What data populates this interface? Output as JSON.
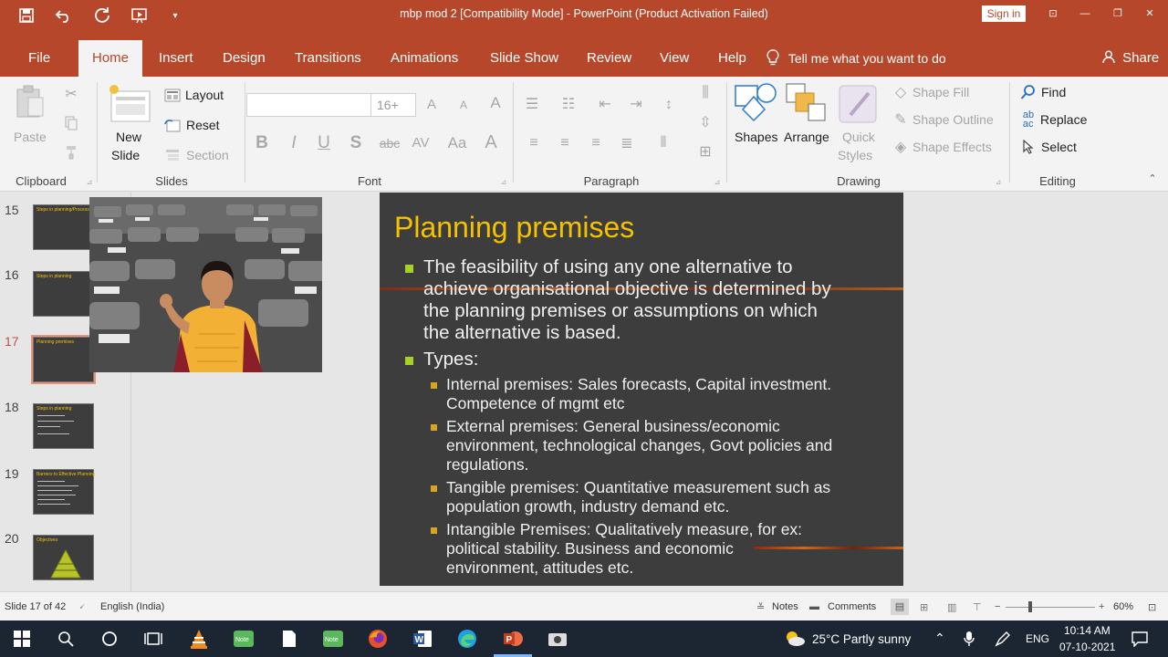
{
  "titlebar": {
    "title": "mbp mod 2 [Compatibility Mode]  -  PowerPoint (Product Activation Failed)",
    "signin": "Sign in",
    "minimize": "—",
    "restore": "❐",
    "close": "✕",
    "ribbon_display": "⊡"
  },
  "tabs": [
    "File",
    "Home",
    "Insert",
    "Design",
    "Transitions",
    "Animations",
    "Slide Show",
    "Review",
    "View",
    "Help"
  ],
  "tellme": "Tell me what you want to do",
  "share": "Share",
  "ribbon": {
    "clipboard": {
      "label": "Clipboard",
      "paste": "Paste"
    },
    "slides": {
      "label": "Slides",
      "new_slide": "New",
      "new_slide2": "Slide",
      "layout": "Layout",
      "reset": "Reset",
      "section": "Section"
    },
    "font": {
      "label": "Font",
      "size": "16+"
    },
    "paragraph": {
      "label": "Paragraph"
    },
    "drawing": {
      "label": "Drawing",
      "shapes": "Shapes",
      "arrange": "Arrange",
      "quick": "Quick",
      "styles": "Styles",
      "shape_fill": "Shape Fill",
      "shape_outline": "Shape Outline",
      "shape_effects": "Shape Effects"
    },
    "editing": {
      "label": "Editing",
      "find": "Find",
      "replace": "Replace",
      "select": "Select"
    }
  },
  "thumbnails": [
    {
      "num": "15",
      "title": "Steps in planning/Process of Planning"
    },
    {
      "num": "16",
      "title": "Steps in planning"
    },
    {
      "num": "17",
      "title": "Planning premises"
    },
    {
      "num": "18",
      "title": "Steps in planning"
    },
    {
      "num": "19",
      "title": "Barriers to Effective Planning"
    },
    {
      "num": "20",
      "title": "Objectives"
    }
  ],
  "slide": {
    "title": "Planning premises",
    "bullet1": [
      "The feasibility of using any one alternative to",
      "achieve organisational objective is determined by",
      "the planning premises or assumptions on which",
      "the alternative is based."
    ],
    "bullet2": "Types:",
    "sub": [
      [
        "Internal premises: Sales forecasts, Capital investment.",
        "Competence of mgmt etc"
      ],
      [
        "External premises: General business/economic",
        "environment, technological changes, Govt policies and",
        "regulations."
      ],
      [
        "Tangible premises: Quantitative measurement such as",
        "population growth, industry demand etc."
      ],
      [
        "Intangible Premises: Qualitatively measure, for ex:",
        "political stability. Business  and economic",
        "environment, attitudes etc."
      ]
    ]
  },
  "statusbar": {
    "slide_info": "Slide 17 of 42",
    "language": "English (India)",
    "notes": "Notes",
    "comments": "Comments",
    "zoom": "60%"
  },
  "taskbar": {
    "weather": "25°C  Partly sunny",
    "lang": "ENG",
    "time": "10:14 AM",
    "date": "07-10-2021"
  }
}
